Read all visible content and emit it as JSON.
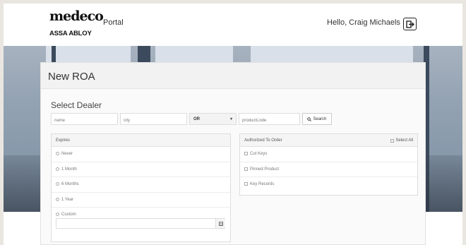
{
  "header": {
    "logo_brand": "medeco",
    "logo_sub": "ASSA ABLOY",
    "portal_label": "Portal",
    "greeting": "Hello, Craig Michaels",
    "logout_icon": "logout-icon"
  },
  "page": {
    "title": "New ROA",
    "section_title": "Select Dealer"
  },
  "dealer_search": {
    "name_placeholder": "name",
    "city_placeholder": "city",
    "operator_value": "OR",
    "productcode_placeholder": "productCode",
    "search_label": "Search"
  },
  "expires": {
    "header": "Expires",
    "options": [
      "Never",
      "1 Month",
      "6 Months",
      "1 Year",
      "Custom"
    ]
  },
  "authorized": {
    "header": "Authorized To Order",
    "select_all_label": "Select All",
    "options": [
      "Cut Keys",
      "Pinned Product",
      "Key Records"
    ]
  },
  "colors": {
    "panel_bg": "#fafafa",
    "banner": "#8597a9",
    "page_bg": "#e9e6e1"
  }
}
